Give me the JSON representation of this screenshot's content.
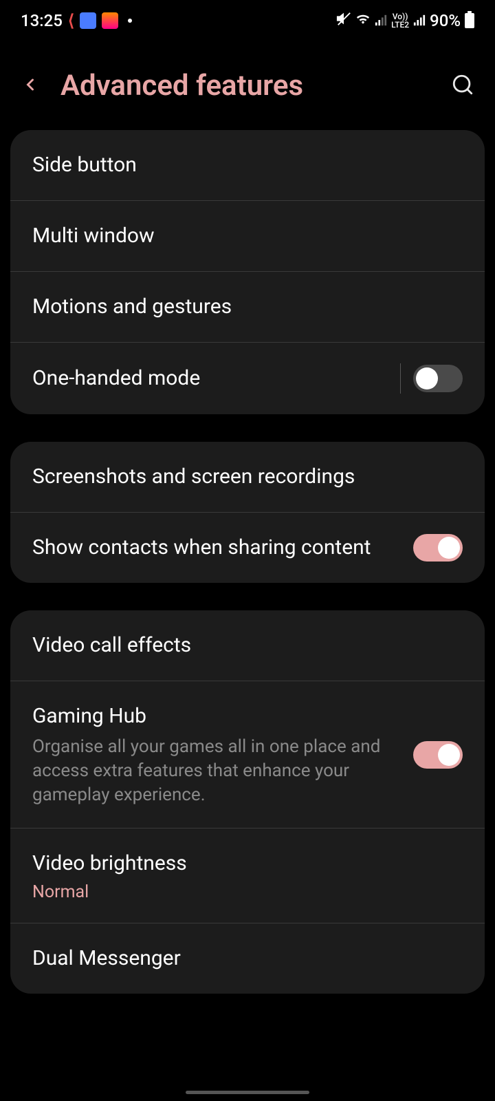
{
  "status": {
    "time": "13:25",
    "lte_label_top": "Vo))",
    "lte_label_bottom": "LTE2",
    "battery_percent": "90%"
  },
  "header": {
    "title": "Advanced features"
  },
  "sections": [
    {
      "rows": [
        {
          "title": "Side button"
        },
        {
          "title": "Multi window"
        },
        {
          "title": "Motions and gestures"
        },
        {
          "title": "One-handed mode",
          "toggle": false,
          "has_divider": true
        }
      ]
    },
    {
      "rows": [
        {
          "title": "Screenshots and screen recordings"
        },
        {
          "title": "Show contacts when sharing content",
          "toggle": true
        }
      ]
    },
    {
      "rows": [
        {
          "title": "Video call effects"
        },
        {
          "title": "Gaming Hub",
          "subtitle": "Organise all your games all in one place and access extra features that enhance your gameplay experience.",
          "toggle": true
        },
        {
          "title": "Video brightness",
          "value": "Normal"
        },
        {
          "title": "Dual Messenger"
        }
      ]
    }
  ],
  "colors": {
    "accent": "#e8a6a6",
    "card": "#1c1c1c",
    "subtext": "#8a8a8a"
  }
}
